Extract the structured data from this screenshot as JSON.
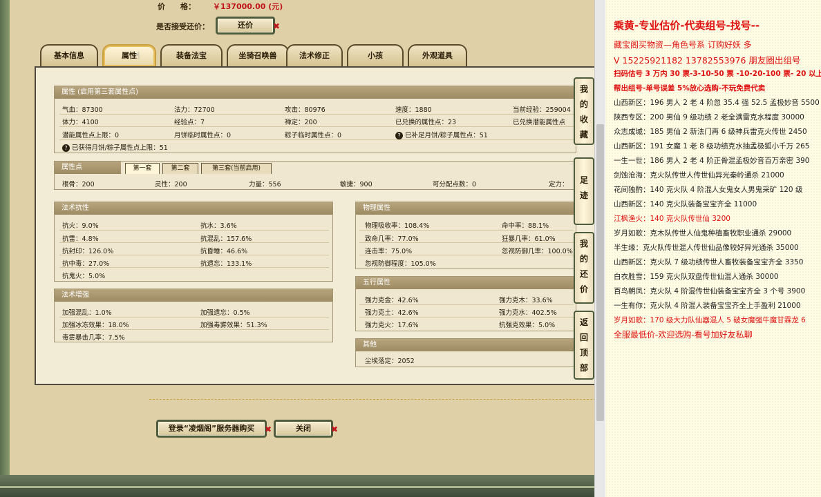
{
  "header": {
    "price_label": "价　　格：",
    "price_value": "￥137000.00 (元)",
    "counter_label": "是否接受还价：",
    "counter_button": "还价"
  },
  "tabs": [
    "基本信息",
    "属性",
    "装备法宝",
    "坐骑召唤兽",
    "法术修正",
    "小孩",
    "外观道具"
  ],
  "attr": {
    "title": "属性 (启用第三套属性点)",
    "rows": [
      [
        "气血：87300",
        "法力：72700",
        "攻击：80976",
        "速度：1880",
        "当前经验：259004"
      ],
      [
        "体力：4100",
        "经验点：7",
        "禅定：200",
        "已兑换的属性点：23",
        "已兑换潜能属性点"
      ],
      [
        "潜能属性点上限：0",
        "月饼临时属性点：0",
        "粽子临时属性点：0",
        "已补足月饼/粽子属性点：51"
      ],
      [
        "已获得月饼/粽子属性点上限：51"
      ]
    ]
  },
  "points": {
    "title": "属性点",
    "tabs": [
      "第一套",
      "第二套",
      "第三套(当前启用)"
    ],
    "row": [
      "根骨：200",
      "灵性：200",
      "力量：556",
      "敏捷：900",
      "可分配点数：0",
      "定力："
    ]
  },
  "resist": {
    "title": "法术抗性",
    "rows": [
      [
        "抗火：9.0%",
        "抗水：3.6%"
      ],
      [
        "抗雷：4.8%",
        "抗混乱：157.6%"
      ],
      [
        "抗封印：126.0%",
        "抗昏睡：46.6%"
      ],
      [
        "抗中毒：27.0%",
        "抗遗忘：133.1%"
      ],
      [
        "抗鬼火：5.0%",
        ""
      ]
    ]
  },
  "enhance": {
    "title": "法术增强",
    "rows": [
      [
        "加强混乱：1.0%",
        "加强遗忘：0.5%"
      ],
      [
        "加强冰冻效果：18.0%",
        "加强毒雾效果：51.3%"
      ],
      [
        "毒雾暴击几率：7.5%",
        ""
      ]
    ]
  },
  "physical": {
    "title": "物理属性",
    "rows": [
      [
        "物理吸收率：108.4%",
        "命中率：88.1%"
      ],
      [
        "致命几率：77.0%",
        "狂暴几率：61.0%"
      ],
      [
        "连击率：75.0%",
        "忽视防御几率：100.0%"
      ],
      [
        "忽视防御程度：105.0%",
        ""
      ]
    ]
  },
  "five": {
    "title": "五行属性",
    "rows": [
      [
        "强力克金：42.6%",
        "强力克木：33.6%"
      ],
      [
        "强力克土：42.6%",
        "强力克水：402.5%"
      ],
      [
        "强力克火：17.6%",
        "抗强克效果：5.0%"
      ]
    ]
  },
  "other": {
    "title": "其他",
    "row": "尘埃落定：2052"
  },
  "side_buttons": [
    [
      "我",
      "的",
      "收",
      "藏"
    ],
    [
      "足",
      "迹"
    ],
    [
      "我",
      "的",
      "还",
      "价"
    ],
    [
      "返",
      "回",
      "顶",
      "部"
    ]
  ],
  "footer": {
    "login_button": "登录“凌烟阁”服务器购买",
    "close_button": "关闭"
  },
  "notes": [
    "乘黄-专业估价-代卖组号-找号--",
    "藏宝阁买物资—角色号系 订购好妖 多",
    "V 15225921182 13782553976 朋友圈出组号",
    "扫码估号 3 万内 30 票-3-10-50 票 -10-20-100 票- 20 以上",
    "帮出组号-单号误差 5%放心选购-不玩免费代卖",
    "山西新区：196 男人 2 老 4 阶忽 35.4 强 52.5 孟极妙音 5500",
    "陕西专区：200 男仙 9 级功绩 2 老全满雷克水程度 30000",
    "众志成城：185 男仙 2 新法门再 6 级神兵雷克火传世 2450",
    "山西新区：191 女魔 1 老 8 级功绩克水抽孟极狐小千万 265",
    "一生一世：186 男人 2 老 4 阶正骨混孟极妙音百万亲密 390",
    "剑蚀沧海：克火队传世人传世仙异光秦岭通杀 21000",
    "花间独酌：140 克火队 4 阶混人女鬼女人男鬼采矿 120 级",
    "山西新区：140 克火队装备宝宝齐全 11000",
    "江枫渔火：140 克火队传世仙 3200",
    "岁月如歌：克木队传世人仙鬼种植畜牧职业通杀 29000",
    "半生缘：克火队传世混人传世仙品像较好异光通杀 35000",
    "山西新区：克火队 7 级功绩传世人畜牧装备宝宝齐全 3350",
    "白衣胜雪：159 克火队双盘传世仙混人通杀 30000",
    "百鸟朝凤：克火队 4 阶混传世仙装备宝宝齐全 3 个号 3900",
    "一生有你：克火队 4 阶混人装备宝宝齐全上手盈利 21000",
    "岁月如歌：170 级大力队仙器混人 5 破女魔强牛魔甘霖龙 6",
    "全服最低价-欢迎选购-看号加好友私聊"
  ]
}
